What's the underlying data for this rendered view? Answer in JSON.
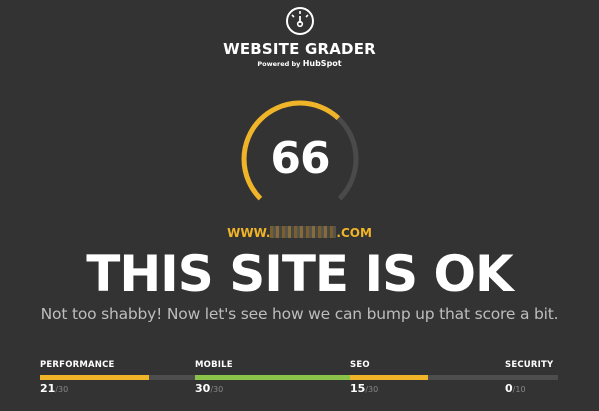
{
  "header": {
    "title": "WEBSITE GRADER",
    "powered_by": "Powered by",
    "brand": "HubSpot",
    "icon": "speedometer-icon"
  },
  "gauge": {
    "score": "66",
    "score_value": 66,
    "max": 100,
    "accent": "#f0b429",
    "track": "#4a4a4a"
  },
  "site": {
    "prefix": "WWW.",
    "suffix": ".COM"
  },
  "verdict": "THIS SITE IS OK",
  "subtitle": "Not too shabby! Now let's see how we can bump up that score a bit.",
  "metrics": [
    {
      "label": "PERFORMANCE",
      "score": "21",
      "max": "/30",
      "fraction": 0.7,
      "color": "#f0b429"
    },
    {
      "label": "MOBILE",
      "score": "30",
      "max": "/30",
      "fraction": 1.0,
      "color": "#8bc34a"
    },
    {
      "label": "SEO",
      "score": "15",
      "max": "/30",
      "fraction": 0.5,
      "color": "#f0b429"
    },
    {
      "label": "SECURITY",
      "score": "0",
      "max": "/10",
      "fraction": 0.0,
      "color": "#f0b429"
    }
  ]
}
